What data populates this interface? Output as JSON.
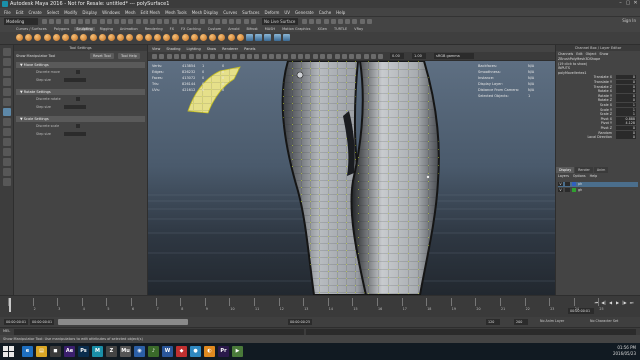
{
  "window": {
    "title": "Autodesk Maya 2016 - Not for Resale: untitled*   ---   polySurface1",
    "controls": [
      "–",
      "▢",
      "✕"
    ]
  },
  "menubar": [
    "File",
    "Edit",
    "Create",
    "Select",
    "Modify",
    "Display",
    "Windows",
    "Mesh",
    "Edit Mesh",
    "Mesh Tools",
    "Mesh Display",
    "Curves",
    "Surfaces",
    "Deform",
    "UV",
    "Generate",
    "Cache",
    "Help"
  ],
  "status_line": {
    "mode": "Modeling",
    "live_surface": "No Live Surface",
    "sign_in": "Sign In"
  },
  "shelf_tabs": [
    "Curves / Surfaces",
    "Polygons",
    "Sculpting",
    "Rigging",
    "Animation",
    "Rendering",
    "FX",
    "FX Caching",
    "Custom",
    "Arnold",
    "Bifrost",
    "MASH",
    "Motion Graphics",
    "XGen",
    "TURTLE",
    "VRay"
  ],
  "shelf_active": "Sculpting",
  "tool_settings": {
    "panel_title": "Tool Settings",
    "tool_name": "Show Manipulator Tool",
    "reset_label": "Reset Tool",
    "help_label": "Tool Help",
    "frames": [
      {
        "title": "Move Settings",
        "rows": [
          "Discrete move",
          "Step size"
        ]
      },
      {
        "title": "Rotate Settings",
        "rows": [
          "Discrete rotate",
          "Step size"
        ]
      },
      {
        "title": "Scale Settings",
        "rows": [
          "Discrete scale",
          "Step size"
        ]
      }
    ]
  },
  "viewport": {
    "menu": [
      "View",
      "Shading",
      "Lighting",
      "Show",
      "Renderer",
      "Panels"
    ],
    "exposure": "0.00",
    "gamma": "1.00",
    "color_space": "sRGB gamma",
    "hud_left": [
      {
        "k": "Verts:",
        "a": "413854",
        "b": "1",
        "c": "0"
      },
      {
        "k": "Edges:",
        "a": "826232",
        "b": "0",
        "c": "0"
      },
      {
        "k": "Faces:",
        "a": "413072",
        "b": "0",
        "c": "0"
      },
      {
        "k": "Tris:",
        "a": "826144",
        "b": "0",
        "c": "0"
      },
      {
        "k": "UVs:",
        "a": "421612",
        "b": "0",
        "c": "0"
      }
    ],
    "hud_right": [
      {
        "k": "Backfaces:",
        "v": "N/A"
      },
      {
        "k": "Smoothness:",
        "v": "N/A"
      },
      {
        "k": "Instance:",
        "v": "N/A"
      },
      {
        "k": "Display Layer:",
        "v": "N/A"
      },
      {
        "k": "Distance From Camera:",
        "v": "N/A"
      },
      {
        "k": "Selected Objects:",
        "v": "1"
      }
    ]
  },
  "channel_box": {
    "panel_title": "Channel Box / Layer Editor",
    "menu": [
      "Channels",
      "Edit",
      "Object",
      "Show"
    ],
    "header_lines": [
      "ZBrushPolyMesh3DShape",
      "(19 click to show)",
      "INPUTS",
      "polyMoveVertex1"
    ],
    "channels": [
      {
        "n": "Translate X",
        "v": "0"
      },
      {
        "n": "Translate Y",
        "v": "0"
      },
      {
        "n": "Translate Z",
        "v": "0"
      },
      {
        "n": "Rotate X",
        "v": "0"
      },
      {
        "n": "Rotate Y",
        "v": "0"
      },
      {
        "n": "Rotate Z",
        "v": "0"
      },
      {
        "n": "Scale X",
        "v": "1"
      },
      {
        "n": "Scale Y",
        "v": "1"
      },
      {
        "n": "Scale Z",
        "v": "1"
      },
      {
        "n": "Pivot X",
        "v": "0.888"
      },
      {
        "n": "Pivot Y",
        "v": "4.128"
      },
      {
        "n": "Pivot Z",
        "v": "0"
      },
      {
        "n": "Random",
        "v": "0"
      },
      {
        "n": "Local Direction",
        "v": "0"
      }
    ],
    "layer_tabs": [
      "Display",
      "Render",
      "Anim"
    ],
    "layer_tab_active": "Display",
    "layer_menu": [
      "Layers",
      "Options",
      "Help"
    ],
    "layers": [
      {
        "v": "V",
        "name": "ph",
        "color": "#3060c0",
        "selected": true
      },
      {
        "v": "V",
        "name": "gh",
        "color": "#30a030",
        "selected": false
      }
    ]
  },
  "time_slider": {
    "ticks": [
      "1",
      "2",
      "3",
      "4",
      "5",
      "6",
      "7",
      "8",
      "9",
      "10",
      "11",
      "12",
      "13",
      "14",
      "15",
      "16",
      "17",
      "18",
      "19",
      "20",
      "21",
      "22",
      "23",
      "24",
      "25"
    ],
    "current_frame_display": "00:00:00:01",
    "playback": [
      "⏮",
      "◀|",
      "◀",
      "▶",
      "|▶",
      "⏭"
    ]
  },
  "range_slider": {
    "start": "00:00:00:01",
    "range_start": "00:00:00:01",
    "range_end": "00:00:00:25",
    "end": "00:00:00:25",
    "fields": [
      "120",
      "200"
    ],
    "anim_layer": "No Anim Layer",
    "char_set": "No Character Set"
  },
  "command_line": {
    "lang": "MEL"
  },
  "help_line": "Show Manipulator Tool: Use manipulators to edit attributes of selected object(s)",
  "taskbar": {
    "apps": [
      {
        "label": "e",
        "color": "#1e6fc0"
      },
      {
        "label": "▤",
        "color": "#d9a625"
      },
      {
        "label": "◼",
        "color": "#3a3a3a"
      },
      {
        "label": "Ae",
        "color": "#3b1f6e"
      },
      {
        "label": "Ps",
        "color": "#0b2d4d"
      },
      {
        "label": "M",
        "color": "#1a8fa8"
      },
      {
        "label": "Z",
        "color": "#444"
      },
      {
        "label": "Mu",
        "color": "#555"
      },
      {
        "label": "◉",
        "color": "#2b5fa6"
      },
      {
        "label": "♪",
        "color": "#3a6a2a"
      },
      {
        "label": "W",
        "color": "#2a5699"
      },
      {
        "label": "◆",
        "color": "#c03030"
      },
      {
        "label": "●",
        "color": "#2f88c0"
      },
      {
        "label": "◐",
        "color": "#e08a20"
      },
      {
        "label": "Pr",
        "color": "#2a1a4a"
      },
      {
        "label": "▶",
        "color": "#4a7a3a"
      }
    ],
    "time": "01:56 PM",
    "date": "2016/05/23"
  }
}
